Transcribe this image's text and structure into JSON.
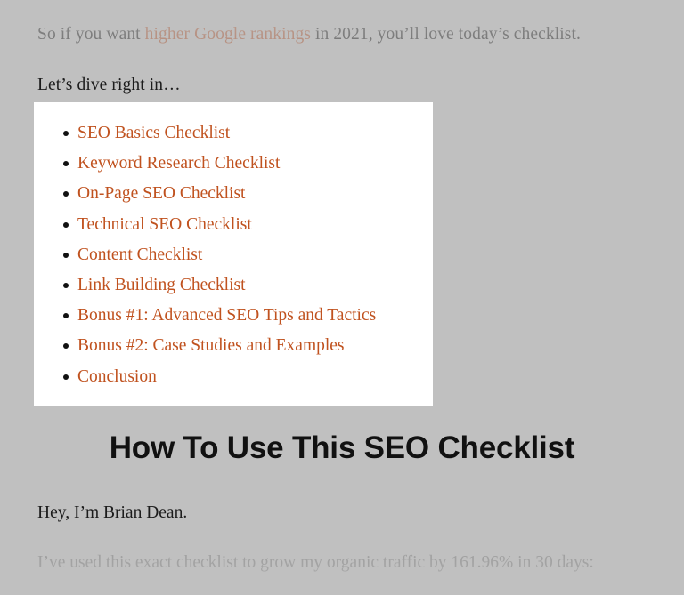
{
  "page": {
    "background_color": "#c0c0c0",
    "body_text_color": "#1c1c1c",
    "muted_text_color": "#6e6e6e",
    "faded_text_color": "#989898",
    "link_color": "#c0521f",
    "faded_link_color": "#b58977"
  },
  "intro": {
    "before_link": "So if you want ",
    "link_text": "higher Google rankings",
    "after_link": " in 2021, you’ll love today’s checklist."
  },
  "lead": {
    "text": "Let’s dive right in…"
  },
  "toc": {
    "background_color": "#ffffff",
    "bullet_color": "#111111",
    "items": [
      {
        "label": "SEO Basics Checklist"
      },
      {
        "label": "Keyword Research Checklist"
      },
      {
        "label": "On-Page SEO Checklist"
      },
      {
        "label": "Technical SEO Checklist"
      },
      {
        "label": "Content Checklist"
      },
      {
        "label": "Link Building Checklist"
      },
      {
        "label": "Bonus #1: Advanced SEO Tips and Tactics"
      },
      {
        "label": "Bonus #2: Case Studies and Examples"
      },
      {
        "label": "Conclusion"
      }
    ]
  },
  "section": {
    "heading": "How To Use This SEO Checklist"
  },
  "closing": {
    "signature": "Hey, I’m Brian Dean.",
    "stat_line": "I’ve used this exact checklist to grow my organic traffic by 161.96% in 30 days:"
  }
}
